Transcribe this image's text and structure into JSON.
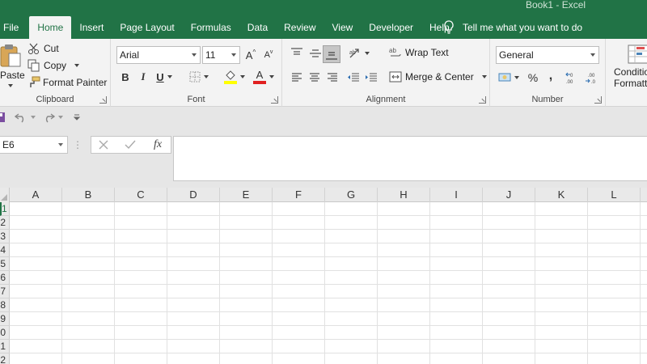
{
  "window": {
    "title": "Book1  -  Excel"
  },
  "tabs": [
    {
      "label": "File"
    },
    {
      "label": "Home",
      "active": true
    },
    {
      "label": "Insert"
    },
    {
      "label": "Page Layout"
    },
    {
      "label": "Formulas"
    },
    {
      "label": "Data"
    },
    {
      "label": "Review"
    },
    {
      "label": "View"
    },
    {
      "label": "Developer"
    },
    {
      "label": "Help"
    }
  ],
  "tell_me": {
    "text": "Tell me what you want to do",
    "icon": "lightbulb-icon"
  },
  "clipboard": {
    "label": "Clipboard",
    "paste": "Paste",
    "cut": "Cut",
    "copy": "Copy",
    "format_painter": "Format Painter"
  },
  "font": {
    "label": "Font",
    "name": "Arial",
    "size": "11",
    "grow": "A",
    "shrink": "A",
    "bold": "B",
    "italic": "I",
    "underline": "U",
    "font_color_letter": "A",
    "font_color": "#e02020",
    "fill_color": "#ffff00"
  },
  "alignment": {
    "label": "Alignment",
    "wrap_text": "Wrap Text",
    "merge_center": "Merge & Center"
  },
  "number": {
    "label": "Number",
    "format": "General",
    "percent": "%",
    "comma": ","
  },
  "styles": {
    "conditional_line1": "Conditio",
    "conditional_line2": "Formatti"
  },
  "formula_bar": {
    "name_box": "E6",
    "fx": "fx"
  },
  "grid": {
    "columns": [
      "A",
      "B",
      "C",
      "D",
      "E",
      "F",
      "G",
      "H",
      "I",
      "J",
      "K",
      "L"
    ],
    "rows": [
      "1",
      "2",
      "3",
      "4",
      "5",
      "6",
      "7",
      "8",
      "9",
      "0",
      "1",
      "2"
    ]
  },
  "colors": {
    "accent": "#217346",
    "ribbon_bg": "#f3f3f3"
  }
}
